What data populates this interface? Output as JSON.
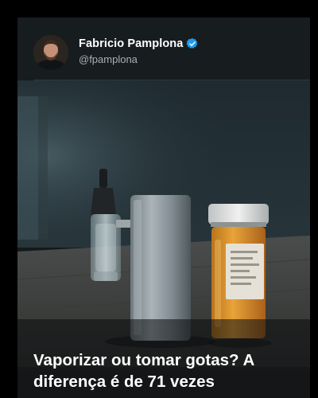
{
  "post": {
    "author_name": "Fabricio Pamplona",
    "author_handle": "@fpamplona",
    "verified": true,
    "headline": "Vaporizar ou tomar gotas? A diferença é de 71 vezes"
  },
  "colors": {
    "verified_badge": "#1d9bf0",
    "text_primary": "#ffffff",
    "text_secondary": "#a8b0b5",
    "pill_bottle": "#e8a33a"
  },
  "icons": [
    "verified-badge-icon"
  ]
}
